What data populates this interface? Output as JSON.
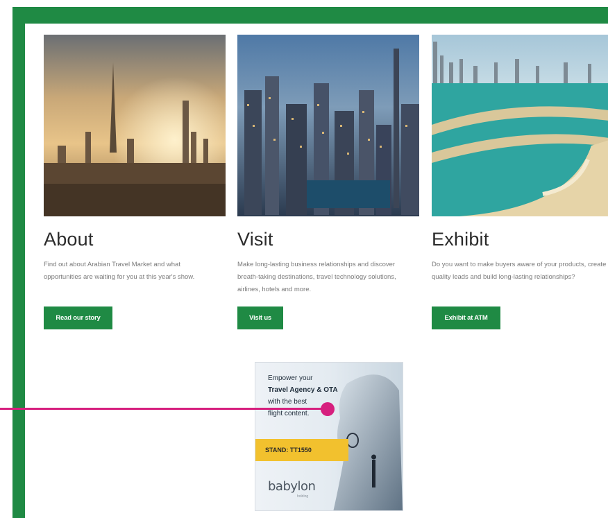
{
  "cards": [
    {
      "title": "About",
      "text": "Find out about Arabian Travel Market and what opportunities are waiting for you at this year's show.",
      "button": "Read our story",
      "image": "dubai-skyline-sunset"
    },
    {
      "title": "Visit",
      "text": "Make long-lasting business relationships and discover breath-taking destinations, travel technology solutions, airlines, hotels and more.",
      "button": "Visit us",
      "image": "dubai-marina-night"
    },
    {
      "title": "Exhibit",
      "text": "Do you want to make buyers aware of your products, create quality leads and build long-lasting relationships?",
      "button": "Exhibit at ATM",
      "image": "palm-jumeirah-aerial"
    }
  ],
  "ad": {
    "line1": "Empower your",
    "line2": "Travel Agency & OTA",
    "line3": "with the best",
    "line4": "flight content.",
    "stand": "STAND: TT1550",
    "logo": "babylon",
    "logo_sub": "holding"
  },
  "colors": {
    "brand_green": "#1f8a44",
    "pointer": "#d61f7e",
    "ad_yellow": "#f2c12e"
  }
}
